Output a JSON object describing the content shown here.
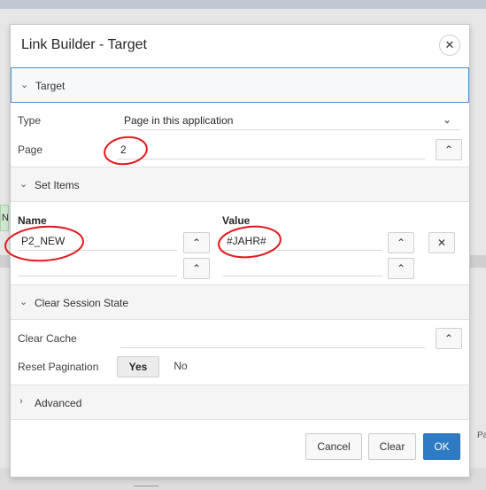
{
  "dialog": {
    "title": "Link Builder - Target",
    "close_icon": "close-icon"
  },
  "target_region": {
    "title": "Target",
    "type_label": "Type",
    "type_value": "Page in this application",
    "page_label": "Page",
    "page_value": "2"
  },
  "set_items_region": {
    "title": "Set Items",
    "name_header": "Name",
    "value_header": "Value",
    "rows": [
      {
        "name": "P2_NEW",
        "value": "#JAHR#"
      },
      {
        "name": "",
        "value": ""
      }
    ]
  },
  "clear_session_region": {
    "title": "Clear Session State",
    "clear_cache_label": "Clear Cache",
    "clear_cache_value": "",
    "reset_pagination_label": "Reset Pagination",
    "options": [
      "Yes",
      "No"
    ],
    "selected": "Yes"
  },
  "advanced_region": {
    "title": "Advanced"
  },
  "footer": {
    "cancel_label": "Cancel",
    "clear_label": "Clear",
    "ok_label": "OK"
  },
  "background": {
    "side_letter": "N",
    "side_text": "Pa"
  },
  "colors": {
    "accent": "#2d7bc2",
    "annotation": "#e0191b",
    "active_border": "#4a8fd1"
  }
}
